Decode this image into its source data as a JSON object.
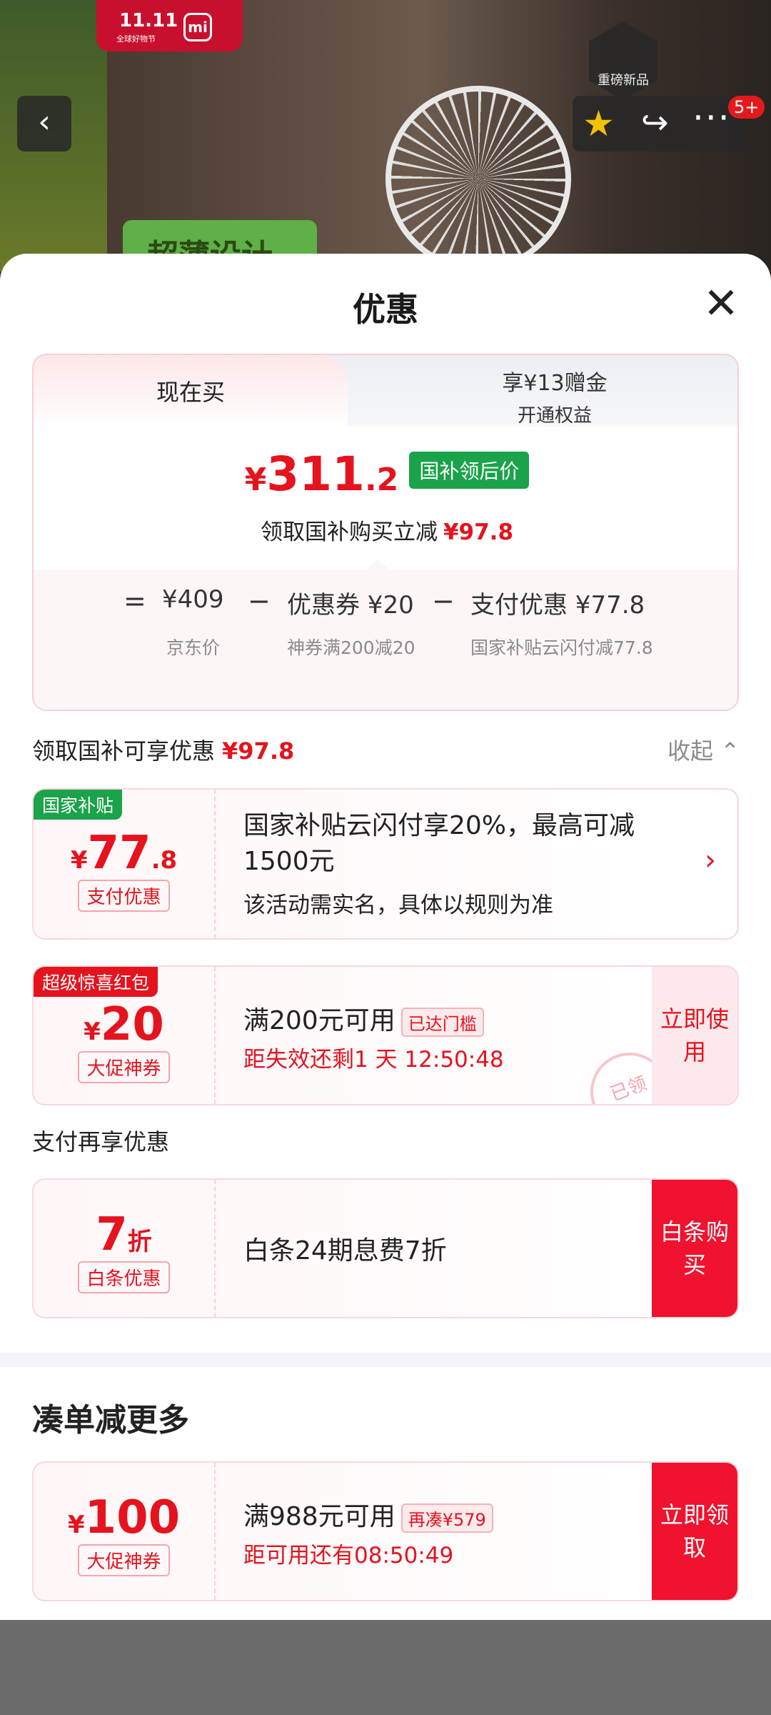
{
  "background": {
    "tag_title": "11.11",
    "tag_subtitle": "全球好物节",
    "brand_logo": "mi",
    "banner_text": "超薄设计",
    "new_badge": "重磅新品",
    "back_icon": "chevron-left-icon",
    "favorite_icon": "star-icon",
    "share_icon": "share-icon",
    "more_icon": "more-dots-icon",
    "notification_count": "5+"
  },
  "sheet": {
    "title": "优惠",
    "close_icon": "close-icon"
  },
  "summary": {
    "tab_now": "现在买",
    "tab_other_line1": "享¥13赠金",
    "tab_other_line2": "开通权益",
    "price_currency": "¥",
    "price_int": "311",
    "price_dec": ".2",
    "price_badge": "国补领后价",
    "desc_text": "领取国补购买立减",
    "desc_amount": "¥97.8",
    "calc": {
      "eq": "=",
      "minus": "−",
      "items": [
        {
          "value": "¥409",
          "label": "京东价"
        },
        {
          "value": "优惠券 ¥20",
          "label": "神券满200减20"
        },
        {
          "value": "支付优惠 ¥77.8",
          "label": "国家补贴云闪付减77.8"
        }
      ]
    }
  },
  "section1": {
    "title": "领取国补可享优惠",
    "amount": "¥97.8",
    "collapse_label": "收起"
  },
  "coupons": [
    {
      "corner": "国家补贴",
      "cur": "¥",
      "big": "77",
      "small": ".8",
      "label": "支付优惠",
      "title": "国家补贴云闪付享20%，最高可减1500元",
      "subtitle": "该活动需实名，具体以规则为准"
    },
    {
      "corner": "超级惊喜红包",
      "cur": "¥",
      "big": "20",
      "small": "",
      "label": "大促神券",
      "title": "满200元可用",
      "tag": "已达门槛",
      "subtitle": "距失效还剩1 天 12:50:48",
      "button": "立即使用",
      "stamp": "已领"
    }
  ],
  "section2": {
    "title": "支付再享优惠"
  },
  "baitiao": {
    "big": "7",
    "small": "折",
    "label": "白条优惠",
    "title": "白条24期息费7折",
    "button": "白条购买"
  },
  "section3": {
    "title": "凑单减更多"
  },
  "bundle": {
    "cur": "¥",
    "big": "100",
    "label": "大促神券",
    "title": "满988元可用",
    "tag": "再凑¥579",
    "subtitle": "距可用还有08:50:49",
    "button": "立即领取"
  },
  "colors": {
    "accent_red": "#e4131e",
    "button_red": "#f0122e",
    "green_badge": "#1aa34a"
  }
}
